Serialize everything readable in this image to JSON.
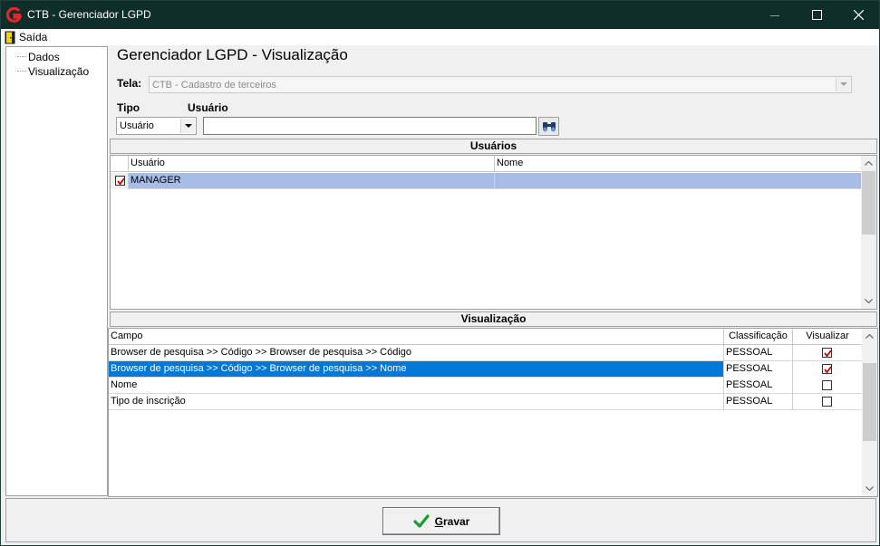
{
  "window": {
    "title": "CTB - Gerenciador LGPD",
    "minimize_icon": "minimize-icon",
    "maximize_icon": "maximize-icon",
    "close_icon": "close-icon"
  },
  "menu": {
    "items": [
      {
        "label": "Saída",
        "icon": "exit-door-icon"
      }
    ]
  },
  "tree": {
    "items": [
      {
        "label": "Dados"
      },
      {
        "label": "Visualização"
      }
    ]
  },
  "main": {
    "title": "Gerenciador LGPD - Visualização",
    "tela_label": "Tela:",
    "tela_value": "CTB - Cadastro de terceiros",
    "tipo_label": "Tipo",
    "tipo_value": "Usuário",
    "usuario_label": "Usuário",
    "usuario_value": "",
    "search_icon": "binoculars-icon"
  },
  "usuarios": {
    "section_title": "Usuários",
    "columns": [
      "Usuário",
      "Nome"
    ],
    "rows": [
      {
        "checked": true,
        "usuario": "MANAGER",
        "nome": ""
      }
    ]
  },
  "visualizacao": {
    "section_title": "Visualização",
    "columns": [
      "Campo",
      "Classificação",
      "Visualizar"
    ],
    "rows": [
      {
        "campo": "Browser de pesquisa >> Código >> Browser de pesquisa >> Código",
        "classificacao": "PESSOAL",
        "visualizar": true
      },
      {
        "campo": "Browser de pesquisa >> Código >> Browser de pesquisa >> Nome",
        "classificacao": "PESSOAL",
        "visualizar": true
      },
      {
        "campo": "Nome",
        "classificacao": "PESSOAL",
        "visualizar": false
      },
      {
        "campo": "Tipo de inscrição",
        "classificacao": "PESSOAL",
        "visualizar": false
      }
    ]
  },
  "footer": {
    "save_label_first": "G",
    "save_label_rest": "ravar",
    "save_icon": "checkmark-icon"
  },
  "colors": {
    "titlebar": "#0f2e2a",
    "selected_row_user": "#a8bce8",
    "selected_row_field": "#0078d7",
    "check_red": "#d00000"
  }
}
